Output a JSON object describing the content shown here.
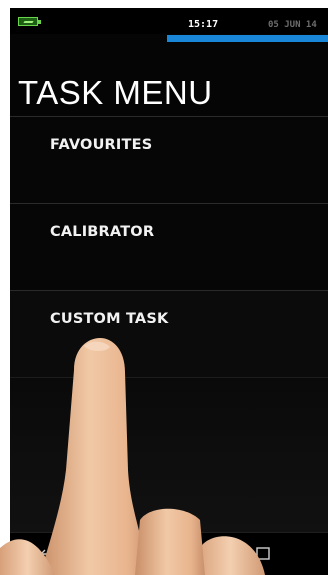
{
  "status_bar": {
    "time": "15:17",
    "date": "05 JUN 14",
    "battery_icon": "battery-charging-icon",
    "progress_fraction": 1.0,
    "progress_color": "#1a86d8"
  },
  "page": {
    "title": "TASK MENU"
  },
  "menu": {
    "items": [
      {
        "label": "FAVOURITES"
      },
      {
        "label": "CALIBRATOR"
      },
      {
        "label": "CUSTOM TASK"
      }
    ]
  },
  "nav_bar": {
    "back_icon": "back-arrow-icon",
    "recent_icon": "recent-apps-icon"
  }
}
